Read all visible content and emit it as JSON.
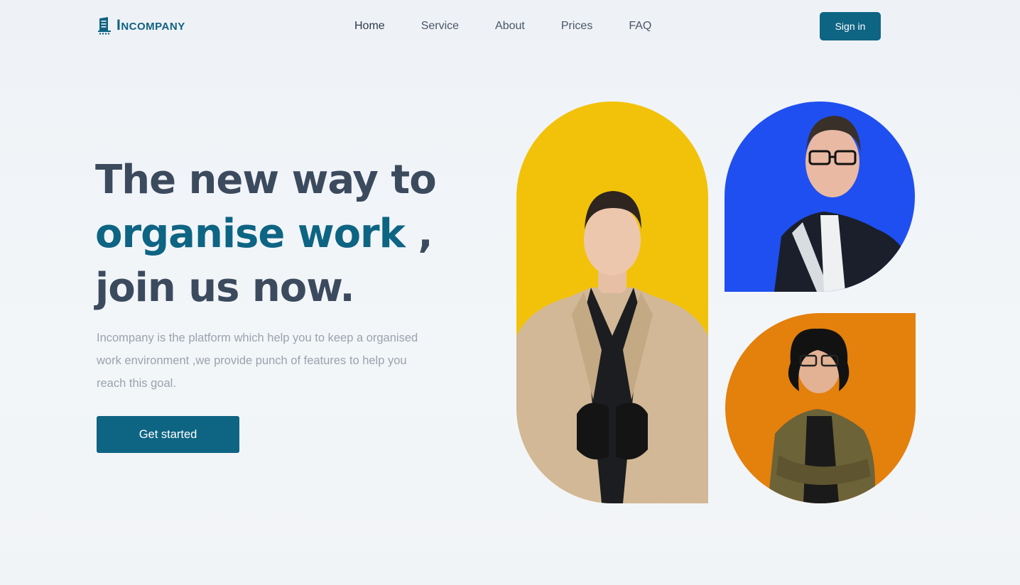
{
  "brand": {
    "name": "Incompany",
    "icon": "building-icon",
    "color": "#0f6282"
  },
  "nav": {
    "items": [
      {
        "label": "Home",
        "active": true
      },
      {
        "label": "Service",
        "active": false
      },
      {
        "label": "About",
        "active": false
      },
      {
        "label": "Prices",
        "active": false
      },
      {
        "label": "FAQ",
        "active": false
      }
    ],
    "signin_label": "Sign in"
  },
  "hero": {
    "title_line1": "The new way to",
    "title_accent": "organise work",
    "title_comma": " ,",
    "title_line3": "join us now.",
    "description": "Incompany is the platform which help you to keep a organised work environment ,we provide punch of features to help you reach this goal.",
    "cta_label": "Get started"
  },
  "colors": {
    "accent": "#0e6483",
    "heading": "#3c4a5e",
    "yellow": "#f2c20a",
    "blue": "#1f4ff0",
    "orange": "#e4800c"
  },
  "images": [
    {
      "name": "person-beige-coat-photo",
      "bg": "yellow"
    },
    {
      "name": "person-glasses-suit-photo",
      "bg": "blue"
    },
    {
      "name": "person-curly-hair-jacket-photo",
      "bg": "orange"
    }
  ]
}
